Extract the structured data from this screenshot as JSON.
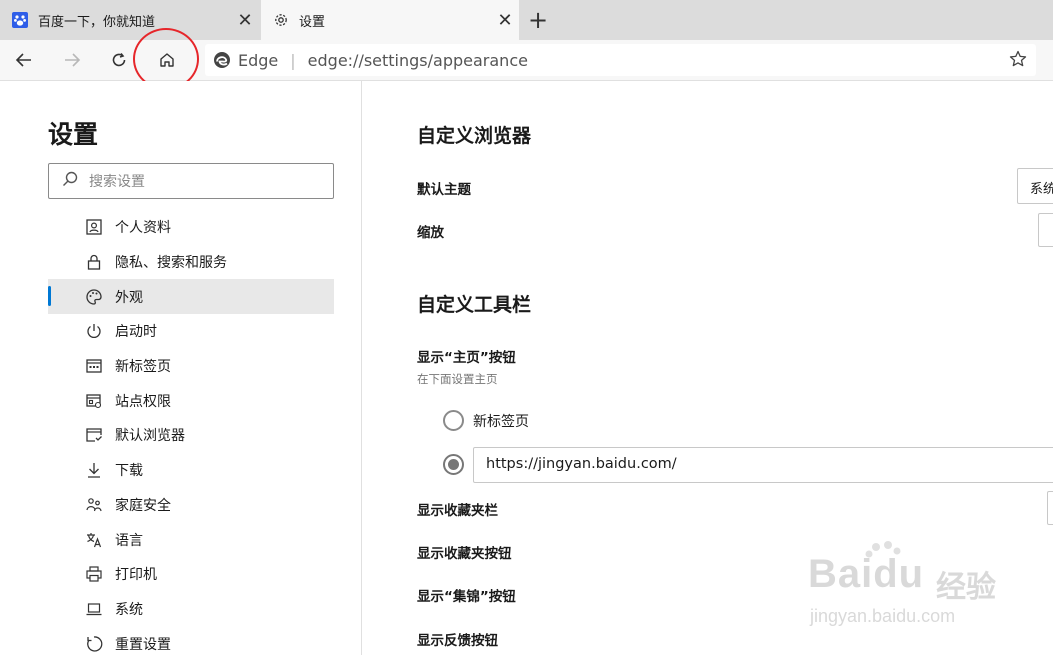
{
  "tabs": [
    {
      "title": "百度一下，你就知道",
      "icon": "baidu-paw-icon",
      "close": "✕"
    },
    {
      "title": "设置",
      "icon": "gear-icon",
      "close": "✕"
    }
  ],
  "newtab": "+",
  "address": {
    "brand": "Edge",
    "separator": "|",
    "url": "edge://settings/appearance"
  },
  "sidebar": {
    "title": "设置",
    "search_placeholder": "搜索设置",
    "items": [
      {
        "label": "个人资料",
        "icon": "profile-icon"
      },
      {
        "label": "隐私、搜索和服务",
        "icon": "lock-icon"
      },
      {
        "label": "外观",
        "icon": "palette-icon",
        "active": true
      },
      {
        "label": "启动时",
        "icon": "power-icon"
      },
      {
        "label": "新标签页",
        "icon": "newtab-icon"
      },
      {
        "label": "站点权限",
        "icon": "site-permissions-icon"
      },
      {
        "label": "默认浏览器",
        "icon": "default-browser-icon"
      },
      {
        "label": "下载",
        "icon": "download-icon"
      },
      {
        "label": "家庭安全",
        "icon": "family-icon"
      },
      {
        "label": "语言",
        "icon": "language-icon"
      },
      {
        "label": "打印机",
        "icon": "printer-icon"
      },
      {
        "label": "系统",
        "icon": "system-icon"
      },
      {
        "label": "重置设置",
        "icon": "reset-icon"
      }
    ]
  },
  "main": {
    "section1_title": "自定义浏览器",
    "theme_label": "默认主题",
    "theme_value": "系统",
    "zoom_label": "缩放",
    "section2_title": "自定义工具栏",
    "home_label": "显示“主页”按钮",
    "home_sub": "在下面设置主页",
    "radio_newtab": "新标签页",
    "home_url": "https://jingyan.baidu.com/",
    "favbar_label": "显示收藏夹栏",
    "favbtn_label": "显示收藏夹按钮",
    "collections_label": "显示“集锦”按钮",
    "feedback_label": "显示反馈按钮"
  },
  "watermark": {
    "logo": "Baidu",
    "cn": "经验",
    "url": "jingyan.baidu.com"
  },
  "colors": {
    "accent": "#0078d4",
    "annotation": "#e6262a"
  }
}
